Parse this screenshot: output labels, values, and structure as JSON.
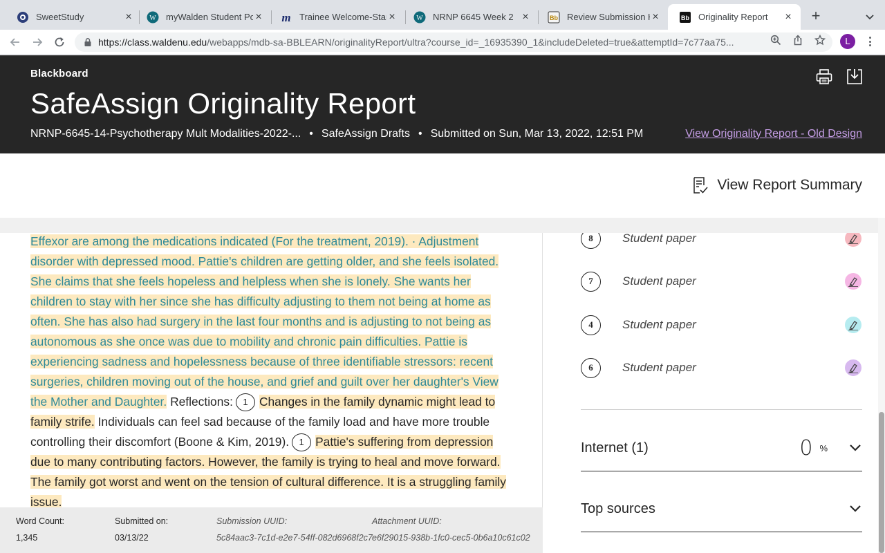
{
  "browser": {
    "tabs": [
      {
        "title": "SweetStudy",
        "icon": "sweetstudy-icon",
        "active": false
      },
      {
        "title": "myWalden Student Por",
        "icon": "walden-icon",
        "active": false
      },
      {
        "title": "Trainee Welcome-Star",
        "icon": "m-icon",
        "active": false
      },
      {
        "title": "NRNP 6645 Week 2",
        "icon": "walden-icon",
        "active": false
      },
      {
        "title": "Review Submission His",
        "icon": "bb-icon",
        "active": false
      },
      {
        "title": "Originality Report",
        "icon": "bb-icon",
        "active": true
      }
    ],
    "url_host": "https://class.waldenu.edu",
    "url_path": "/webapps/mdb-sa-BBLEARN/originalityReport/ultra?course_id=_16935390_1&includeDeleted=true&attemptId=7c77aa75...",
    "profile_initial": "L"
  },
  "header": {
    "brand": "Blackboard",
    "title": "SafeAssign Originality Report",
    "course": "NRNP-6645-14-Psychotherapy Mult Modalities-2022-...",
    "assignment": "SafeAssign Drafts",
    "submitted": "Submitted on Sun, Mar 13, 2022, 12:51 PM",
    "separator": "•",
    "old_design_link": "View Originality Report - Old Design"
  },
  "summary": {
    "button_label": "View Report Summary"
  },
  "document": {
    "seg1": "Effexor are among the medications indicated (For the treatment, 2019). · Adjustment disorder with depressed mood. Pattie's children are getting older, and she feels iso­lated. She claims that she feels hopeless and helpless when she is lonely. She wants her children to stay with her since she has difficulty adjusting to them not being at home as often. She has also had surgery in the last four months and is adjusting to not being as autonomous as she once was due to mobility and chronic pain difficul­ties. Pattie is experiencing sadness and hopelessness because of three identifiable stressors: recent surgeries, children moving out of the house, and grief and guilt over her daughter's View the Mother and Daughter.",
    "seg2": " Reflections:",
    "marker1": "1",
    "seg3": "Changes in the fami­ly dynamic might lead to family strife.",
    "seg4": " Individuals can feel sad because of the family load and have more trouble controlling their discomfort (Boone & Kim, 2019).",
    "marker2": "1",
    "seg5": "Pattie's suffering from depression due to many contributing factors. However, the family is trying to heal and move forward. The family got worst and went on the ten­sion of cultural difference. It is a struggling family issue."
  },
  "footer": {
    "word_count_label": "Word Count:",
    "word_count": "1,345",
    "submitted_label": "Submitted on:",
    "submitted_date": "03/13/22",
    "submission_uuid_label": "Submission UUID:",
    "submission_uuid": "5c84aac3-7c1d-e2e7-54ff-082d6968f2c7",
    "attachment_uuid_label": "Attachment UUID:",
    "attachment_uuid": "e6f29015-938b-1fc0-cec5-0b6a10c61c02"
  },
  "sources": {
    "items": [
      {
        "number": "8",
        "label": "Student paper",
        "color": "#f6b8bf"
      },
      {
        "number": "7",
        "label": "Student paper",
        "color": "#f5b6e4"
      },
      {
        "number": "4",
        "label": "Student paper",
        "color": "#b6ecf0"
      },
      {
        "number": "6",
        "label": "Student paper",
        "color": "#d7b9ef"
      }
    ],
    "internet": {
      "title": "Internet (1)",
      "percent": "0",
      "unit": "%"
    },
    "top_sources": {
      "title": "Top sources"
    }
  }
}
